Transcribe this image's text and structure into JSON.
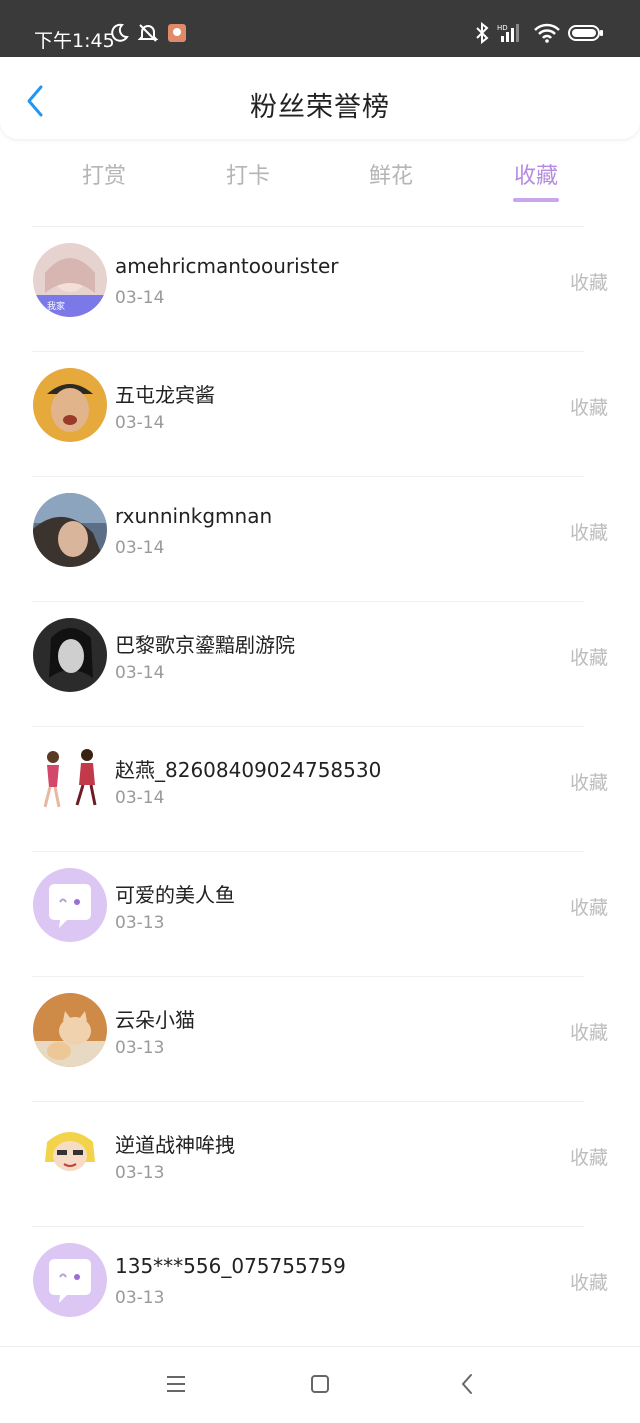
{
  "status_bar": {
    "time": "下午1:45",
    "icons": [
      "moon-icon",
      "bell-off-icon",
      "app-notification-icon",
      "bluetooth-icon",
      "hd-signal-icon",
      "wifi-icon",
      "battery-icon"
    ]
  },
  "header": {
    "title": "粉丝荣誉榜",
    "back_icon": "chevron-left-icon"
  },
  "tabs": [
    {
      "label": "打赏"
    },
    {
      "label": "打卡"
    },
    {
      "label": "鲜花"
    },
    {
      "label": "收藏"
    }
  ],
  "active_tab": "收藏",
  "colors": {
    "accent": "#b58ce0",
    "back_arrow": "#2196f3",
    "muted": "#bdbdbd"
  },
  "list": [
    {
      "name": "amehricmantoourister",
      "date": "03-14",
      "action": "收藏",
      "avatar": "girl-photo"
    },
    {
      "name": "五屯龙宾酱",
      "date": "03-14",
      "action": "收藏",
      "avatar": "man-cap-photo"
    },
    {
      "name": "rxunninkgmnan",
      "date": "03-14",
      "action": "收藏",
      "avatar": "man-photo"
    },
    {
      "name": "巴黎歌京鎏黯剧游院",
      "date": "03-14",
      "action": "收藏",
      "avatar": "bw-woman-photo"
    },
    {
      "name": "赵燕_82608409024758530",
      "date": "03-14",
      "action": "收藏",
      "avatar": "anime-figures"
    },
    {
      "name": "可爱的美人鱼",
      "date": "03-13",
      "action": "收藏",
      "avatar": "default-chat-avatar"
    },
    {
      "name": "云朵小猫",
      "date": "03-13",
      "action": "收藏",
      "avatar": "cat-photo"
    },
    {
      "name": "逆道战神哞拽",
      "date": "03-13",
      "action": "收藏",
      "avatar": "anime-character"
    },
    {
      "name": "135***556_075755759",
      "date": "03-13",
      "action": "收藏",
      "avatar": "default-chat-avatar"
    }
  ],
  "nav_bar": {
    "icons": [
      "menu-icon",
      "home-square-icon",
      "back-chevron-icon"
    ]
  }
}
